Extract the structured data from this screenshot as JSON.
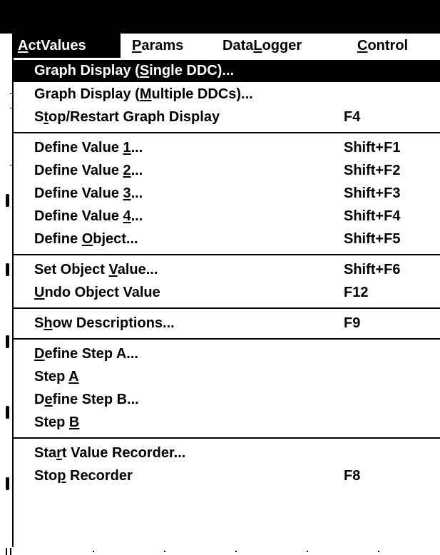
{
  "menubar": {
    "menus": [
      {
        "pre": "",
        "key": "A",
        "post": "ctValues"
      },
      {
        "pre": "",
        "key": "P",
        "post": "arams"
      },
      {
        "pre": "Data",
        "key": "L",
        "post": "ogger"
      },
      {
        "pre": "",
        "key": "C",
        "post": "ontrol"
      }
    ]
  },
  "dropdown": {
    "items": [
      {
        "pre": "Graph Display (",
        "key": "S",
        "post": "ingle DDC)...",
        "shortcut": ""
      },
      {
        "pre": "Graph Display (",
        "key": "M",
        "post": "ultiple DDCs)...",
        "shortcut": ""
      },
      {
        "pre": "S",
        "key": "t",
        "post": "op/Restart Graph Display",
        "shortcut": "F4"
      },
      {
        "pre": "Define Value ",
        "key": "1",
        "post": "...",
        "shortcut": "Shift+F1"
      },
      {
        "pre": "Define Value ",
        "key": "2",
        "post": "...",
        "shortcut": "Shift+F2"
      },
      {
        "pre": "Define Value ",
        "key": "3",
        "post": "...",
        "shortcut": "Shift+F3"
      },
      {
        "pre": "Define Value ",
        "key": "4",
        "post": "...",
        "shortcut": "Shift+F4"
      },
      {
        "pre": "Define ",
        "key": "O",
        "post": "bject...",
        "shortcut": "Shift+F5"
      },
      {
        "pre": "Set Object ",
        "key": "V",
        "post": "alue...",
        "shortcut": "Shift+F6"
      },
      {
        "pre": "",
        "key": "U",
        "post": "ndo Object Value",
        "shortcut": "F12"
      },
      {
        "pre": "S",
        "key": "h",
        "post": "ow Descriptions...",
        "shortcut": "F9"
      },
      {
        "pre": "",
        "key": "D",
        "post": "efine Step A...",
        "shortcut": ""
      },
      {
        "pre": "Step ",
        "key": "A",
        "post": "",
        "shortcut": ""
      },
      {
        "pre": "D",
        "key": "e",
        "post": "fine Step B...",
        "shortcut": ""
      },
      {
        "pre": "Step ",
        "key": "B",
        "post": "",
        "shortcut": ""
      },
      {
        "pre": "Sta",
        "key": "r",
        "post": "t Value Recorder...",
        "shortcut": ""
      },
      {
        "pre": "Sto",
        "key": "p",
        "post": " Recorder",
        "shortcut": "F8"
      }
    ]
  }
}
